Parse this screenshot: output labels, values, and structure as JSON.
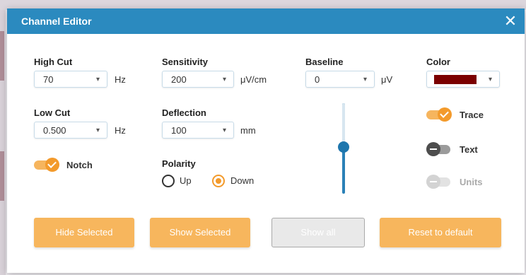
{
  "dialog": {
    "title": "Channel Editor",
    "close_glyph": "✕"
  },
  "high_cut": {
    "label": "High Cut",
    "value": "70",
    "unit": "Hz"
  },
  "low_cut": {
    "label": "Low Cut",
    "value": "0.500",
    "unit": "Hz"
  },
  "notch": {
    "label": "Notch",
    "on": true
  },
  "sensitivity": {
    "label": "Sensitivity",
    "value": "200",
    "unit": "μV/cm"
  },
  "deflection": {
    "label": "Deflection",
    "value": "100",
    "unit": "mm"
  },
  "polarity": {
    "label": "Polarity",
    "options": [
      {
        "label": "Up",
        "checked": false
      },
      {
        "label": "Down",
        "checked": true
      }
    ]
  },
  "baseline": {
    "label": "Baseline",
    "value": "0",
    "unit": "μV",
    "slider_level": 0.5
  },
  "color": {
    "label": "Color",
    "value_hex": "#7b0000"
  },
  "toggles": {
    "trace": {
      "label": "Trace",
      "state": "on"
    },
    "text": {
      "label": "Text",
      "state": "off"
    },
    "units": {
      "label": "Units",
      "state": "disabled"
    }
  },
  "buttons": {
    "hide_selected": "Hide Selected",
    "show_selected": "Show Selected",
    "show_all": "Show all",
    "reset_default": "Reset to default"
  },
  "icons": {
    "caret": "▾",
    "close": "close-icon",
    "check": "check-icon"
  },
  "colors": {
    "title_bar": "#2b8abf",
    "accent": "#f39a2b",
    "button": "#f7b65d"
  }
}
